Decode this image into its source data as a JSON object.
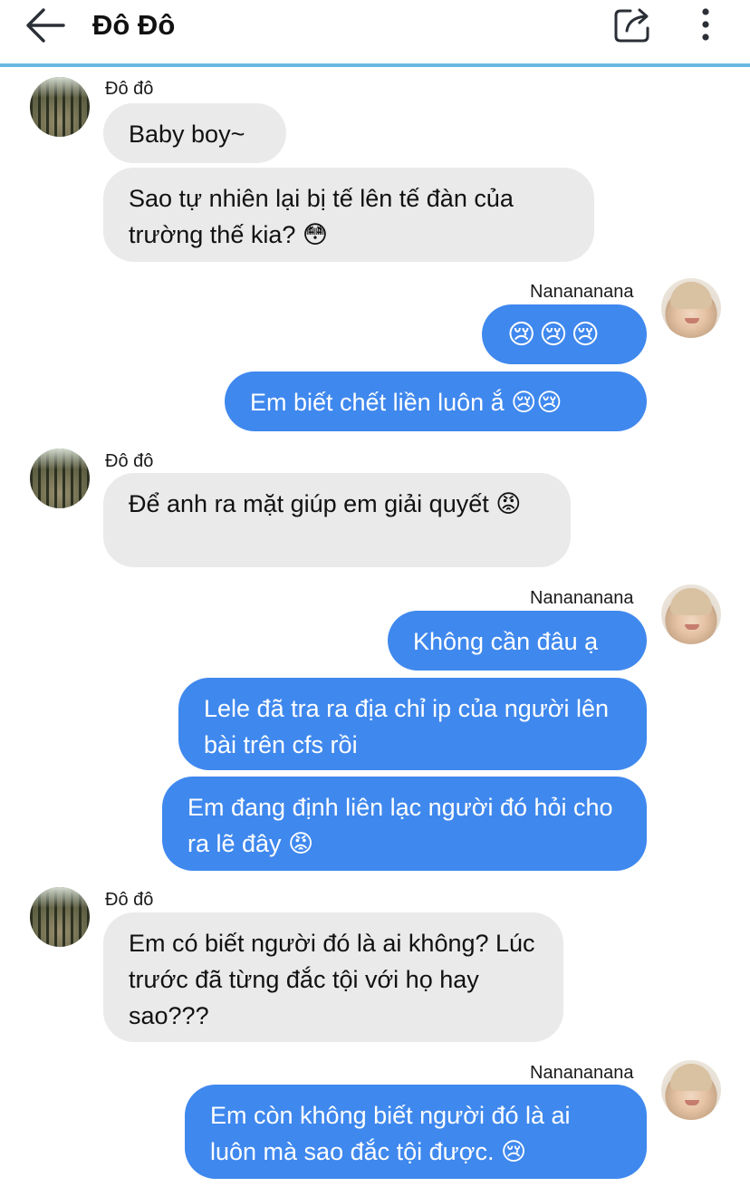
{
  "header": {
    "title": "Đô Đô",
    "accent_line_color": "#6bb7e3"
  },
  "colors": {
    "incoming_bubble": "#eaeaea",
    "outgoing_bubble": "#3f88ee"
  },
  "messages": [
    {
      "sender": "Đô đô",
      "direction": "incoming",
      "text": "Baby boy~"
    },
    {
      "direction": "incoming",
      "text": "Sao tự nhiên lại bị tế lên tế đàn của trường thế kia? 😳"
    },
    {
      "sender": "Nanananana",
      "direction": "outgoing",
      "text": "😢😢😢"
    },
    {
      "direction": "outgoing",
      "text": "Em biết chết liền luôn ắ 😢😢"
    },
    {
      "sender": "Đô đô",
      "direction": "incoming",
      "text": "Để anh ra mặt giúp em giải quyết 😡"
    },
    {
      "sender": "Nanananana",
      "direction": "outgoing",
      "text": "Không cần đâu ạ"
    },
    {
      "direction": "outgoing",
      "text": "Lele đã tra ra địa chỉ ip của người lên bài trên cfs rồi"
    },
    {
      "direction": "outgoing",
      "text": "Em đang định liên lạc người đó hỏi cho ra lẽ đây 😡"
    },
    {
      "sender": "Đô đô",
      "direction": "incoming",
      "text": "Em có biết người đó là ai không? Lúc trước đã từng đắc tội với họ hay sao???"
    },
    {
      "sender": "Nanananana",
      "direction": "outgoing",
      "text": "Em còn không biết người đó là ai luôn mà sao đắc tội được. 😢"
    }
  ]
}
